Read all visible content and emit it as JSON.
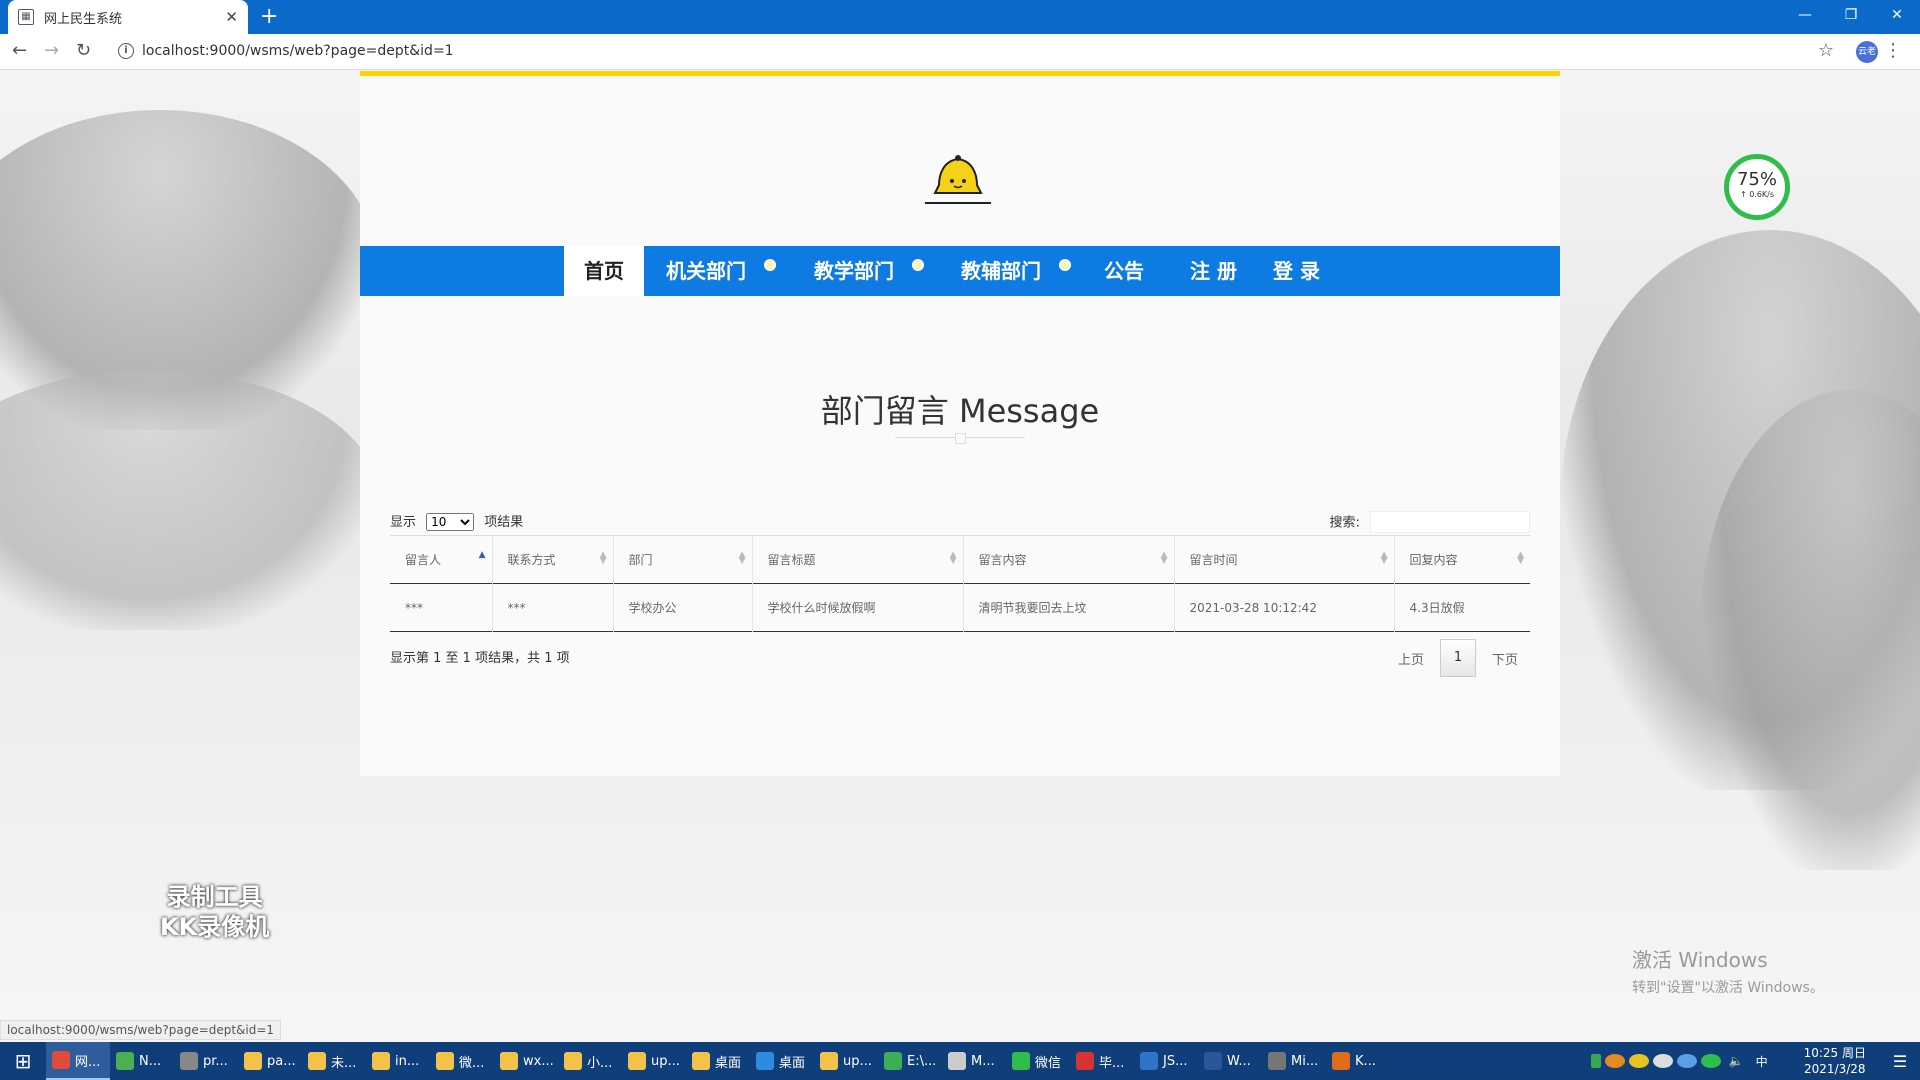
{
  "browser": {
    "tab_title": "网上民生系统",
    "new_tab": "+",
    "url": "localhost:9000/wsms/web?page=dept&id=1",
    "status_url": "localhost:9000/wsms/web?page=dept&id=1",
    "profile": "云老"
  },
  "nav": {
    "items": [
      "首页",
      "机关部门",
      "教学部门",
      "教辅部门",
      "公告",
      "注 册",
      "登 录"
    ]
  },
  "section": {
    "title": "部门留言 Message"
  },
  "table_controls": {
    "show_label": "显示",
    "page_size": "10",
    "result_label": "项结果",
    "search_label": "搜索:",
    "info": "显示第 1 至 1 项结果，共 1 项",
    "prev": "上页",
    "page": "1",
    "next": "下页"
  },
  "table": {
    "columns": [
      "留言人",
      "联系方式",
      "部门",
      "留言标题",
      "留言内容",
      "留言时间",
      "回复内容"
    ],
    "rows": [
      [
        "***",
        "***",
        "学校办公",
        "学校什么时候放假啊",
        "清明节我要回去上坟",
        "2021-03-28 10:12:42",
        "4.3日放假"
      ]
    ]
  },
  "overlay": {
    "meter_pct": "75%",
    "meter_speed": "↑ 0.6K/s",
    "recorder_line1": "录制工具",
    "recorder_line2": "KK录像机",
    "activate_line1": "激活 Windows",
    "activate_line2": "转到\"设置\"以激活 Windows。"
  },
  "taskbar": {
    "items": [
      {
        "label": "网...",
        "color": "#e24b3b"
      },
      {
        "label": "N...",
        "color": "#4caf50"
      },
      {
        "label": "pr...",
        "color": "#888"
      },
      {
        "label": "pa...",
        "color": "#f2c24b"
      },
      {
        "label": "未...",
        "color": "#f2c24b"
      },
      {
        "label": "in...",
        "color": "#f2c24b"
      },
      {
        "label": "微...",
        "color": "#f2c24b"
      },
      {
        "label": "wx...",
        "color": "#f2c24b"
      },
      {
        "label": "小...",
        "color": "#f2c24b"
      },
      {
        "label": "up...",
        "color": "#f2c24b"
      },
      {
        "label": "桌面",
        "color": "#f2c24b"
      },
      {
        "label": "桌面",
        "color": "#2f8be2"
      },
      {
        "label": "up...",
        "color": "#f2c24b"
      },
      {
        "label": "E:\\...",
        "color": "#3cae56"
      },
      {
        "label": "M...",
        "color": "#cccccc"
      },
      {
        "label": "微信",
        "color": "#2fbe4b"
      },
      {
        "label": "毕...",
        "color": "#d93232"
      },
      {
        "label": "JS...",
        "color": "#2f74c9"
      },
      {
        "label": "W...",
        "color": "#2b579a"
      },
      {
        "label": "Mi...",
        "color": "#777"
      },
      {
        "label": "K...",
        "color": "#e06b1a"
      }
    ],
    "ime": "中",
    "time": "10:25 周日",
    "date": "2021/3/28"
  }
}
